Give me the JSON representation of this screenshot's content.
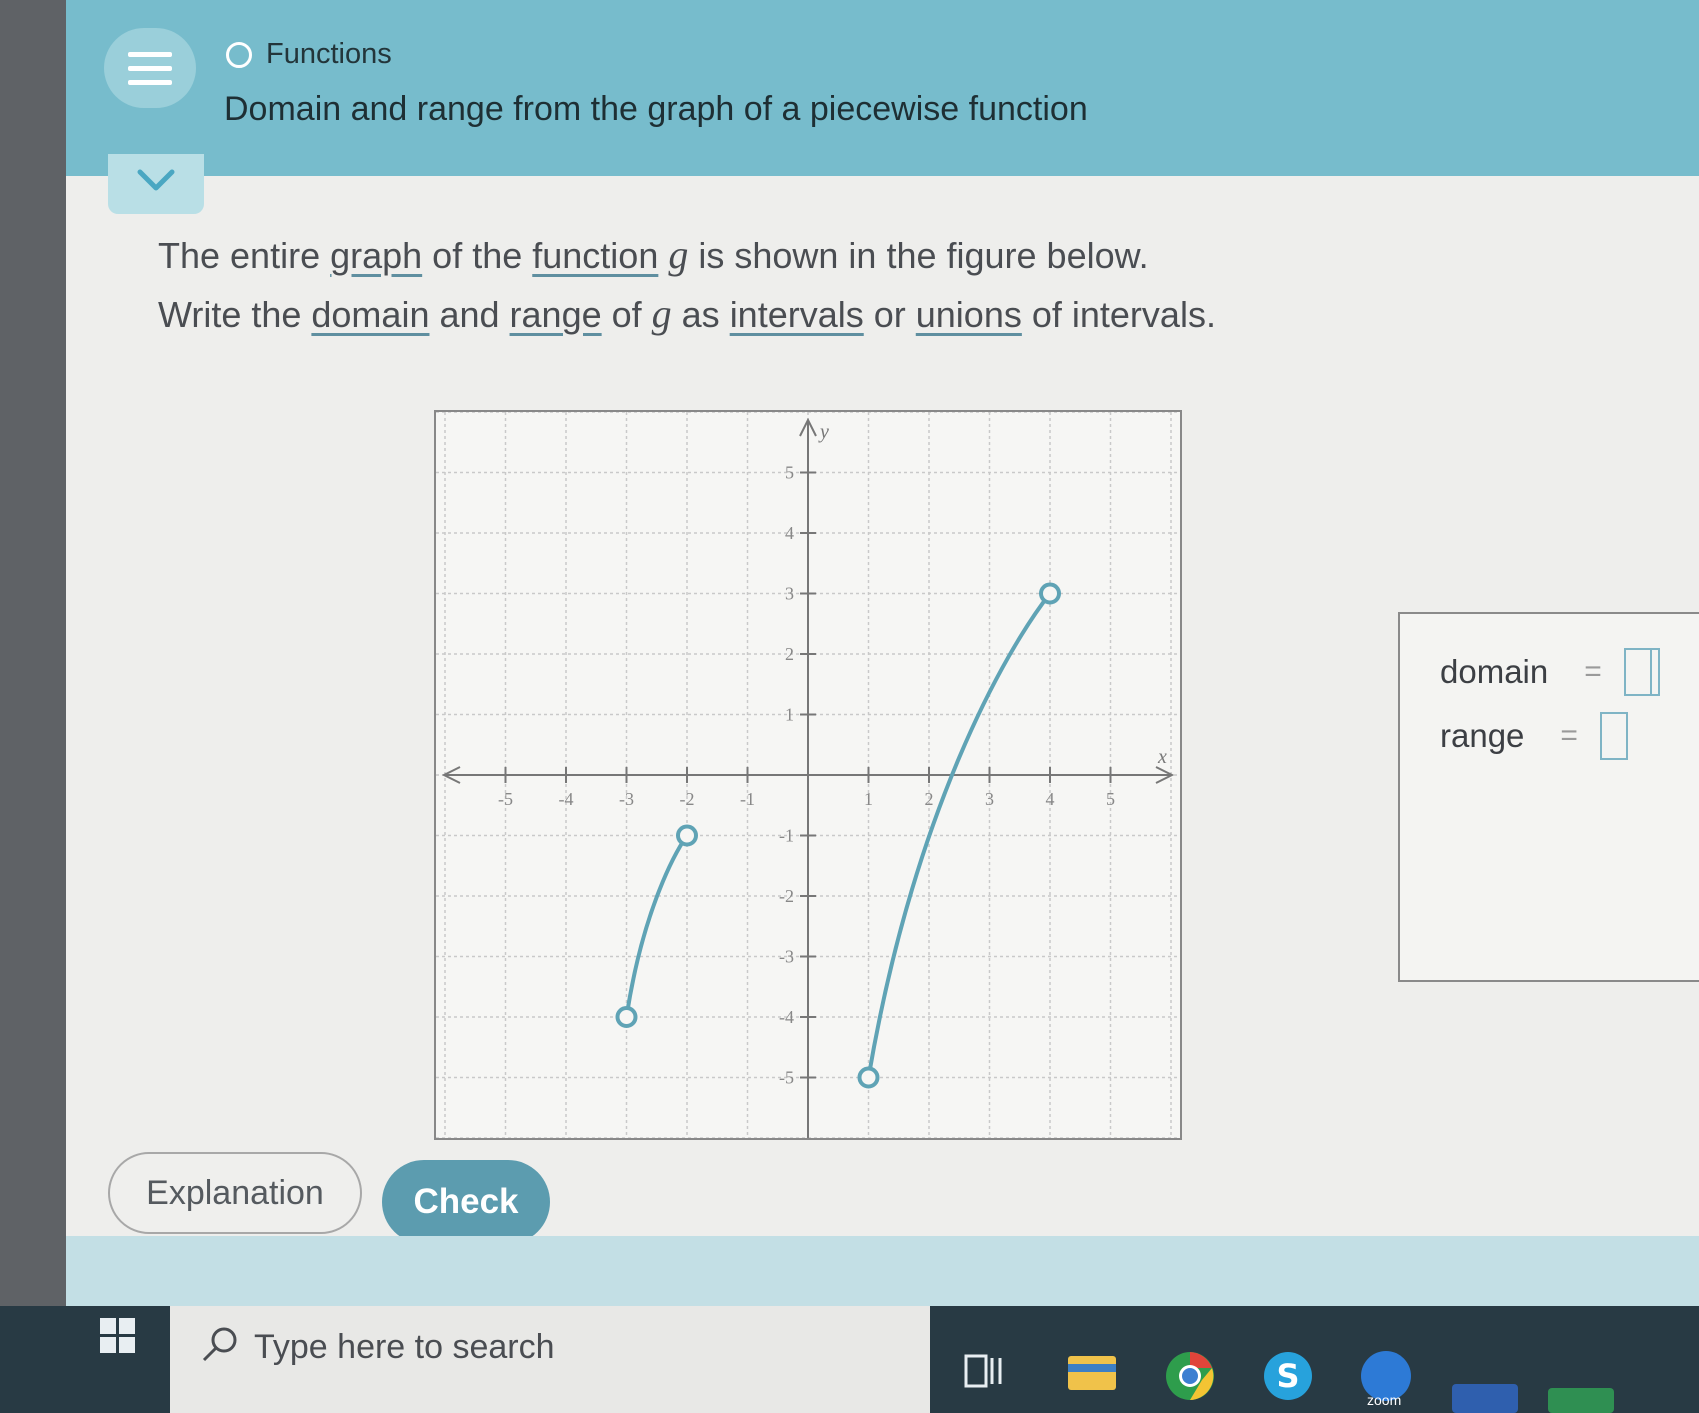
{
  "header": {
    "topic": "Functions",
    "subtitle": "Domain and range from the graph of a piecewise function"
  },
  "question": {
    "line1": {
      "part1": "The entire ",
      "link1": "graph",
      "part2": " of the ",
      "link2": "function",
      "var": "g",
      "part3": " is shown in the figure below."
    },
    "line2": {
      "part1": "Write the ",
      "link1": "domain",
      "part2": " and ",
      "link2": "range",
      "part3": " of ",
      "var": "g",
      "part4": " as ",
      "link3": "intervals",
      "part5": " or ",
      "link4": "unions",
      "part6": " of intervals."
    }
  },
  "graph": {
    "x_axis_label": "x",
    "y_axis_label": "y",
    "x_ticks": [
      -5,
      -4,
      -3,
      -2,
      -1,
      1,
      2,
      3,
      4,
      5
    ],
    "y_ticks": [
      -5,
      -4,
      -3,
      -2,
      -1,
      1,
      2,
      3,
      4,
      5
    ],
    "xlim": [
      -6,
      6
    ],
    "ylim": [
      -6,
      6
    ],
    "segments": [
      {
        "start": [
          -3,
          -4
        ],
        "end": [
          -2,
          -1
        ],
        "start_closed": false,
        "end_closed": false
      },
      {
        "start": [
          1,
          -5
        ],
        "end": [
          4,
          3
        ],
        "start_closed": false,
        "end_closed": false
      }
    ],
    "curve_color": "#5fa3b5"
  },
  "answer": {
    "domain_label": "domain",
    "range_label": "range",
    "equals": "="
  },
  "buttons": {
    "explanation": "Explanation",
    "check": "Check"
  },
  "taskbar": {
    "search_placeholder": "Type here to search",
    "zoom_label": "zoom"
  }
}
